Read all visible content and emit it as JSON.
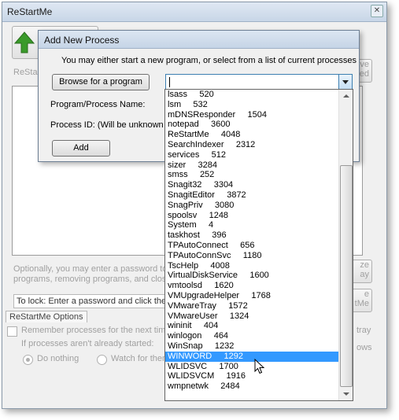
{
  "window": {
    "title": "ReStartMe",
    "close_glyph": "✕",
    "partial_label": "ReStar",
    "right_button_1": [
      "ve",
      "ed"
    ],
    "right_button_2": [
      "ze",
      "ay"
    ],
    "right_button_3": [
      "e",
      "tMe"
    ],
    "password_hint": [
      "Optionally, you may enter a password to p",
      "programs, removing programs, and closin"
    ],
    "lock_field": "To lock: Enter a password and click the l",
    "options_tab": "ReStartMe Options",
    "remember_label": "Remember processes for the next time.",
    "tray_label": "tray",
    "not_started_label": "If processes aren't already started:",
    "ows_label": "ows",
    "do_nothing_label": "Do nothing",
    "watch_label": "Watch for them"
  },
  "dialog": {
    "title": "Add New Process",
    "description": "You may either start a new program, or select from a list of current processes",
    "browse_button": "Browse for a program",
    "program_label": "Program/Process Name:",
    "pid_label": "Process ID: (Will be unknown f",
    "add_button": "Add",
    "combo_value": ""
  },
  "dropdown": {
    "items": [
      "lsass     520",
      "lsm     532",
      "mDNSResponder     1504",
      "notepad     3600",
      "ReStartMe     4048",
      "SearchIndexer     2312",
      "services     512",
      "sizer     3284",
      "smss     252",
      "Snagit32     3304",
      "SnagitEditor     3872",
      "SnagPriv     3080",
      "spoolsv     1248",
      "System     4",
      "taskhost     396",
      "TPAutoConnect     656",
      "TPAutoConnSvc     1180",
      "TscHelp     4008",
      "VirtualDiskService     1600",
      "vmtoolsd     1620",
      "VMUpgradeHelper     1768",
      "VMwareTray     1572",
      "VMwareUser     1324",
      "wininit     404",
      "winlogon     464",
      "WinSnap     1232",
      "WINWORD     1292",
      "WLIDSVC     1700",
      "WLIDSVCM     1916",
      "wmpnetwk     2484"
    ],
    "selected_index": 26
  },
  "colors": {
    "selection": "#3399ff",
    "accent_border": "#3c7fb1",
    "arrow_green": "#3a9a2a"
  }
}
